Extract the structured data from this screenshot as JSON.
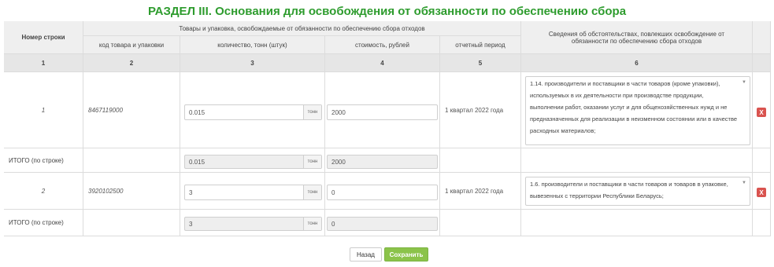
{
  "section_title": "РАЗДЕЛ III. Основания для освобождения от обязанности по обеспечению сбора",
  "headers": {
    "row_number": "Номер строки",
    "goods_group": "Товары и упаковка, освобождаемые от обязанности по обеспечению сбора отходов",
    "code": "код товара и упаковки",
    "quantity": "количество, тонн (штук)",
    "cost": "стоимость, рублей",
    "period": "отчетный период",
    "circumstances": "Сведения об обстоятельствах, повлекших освобождение от обязанности по обеспечению сбора отходов"
  },
  "column_numbers": [
    "1",
    "2",
    "3",
    "4",
    "5",
    "6"
  ],
  "rows": [
    {
      "number": "1",
      "code": "8467119000",
      "quantity": "0.015",
      "unit": "тонн",
      "cost": "2000",
      "period": "1 квартал 2022 года",
      "reason": "1.14. производители и поставщики в части товаров (кроме упаковки), используемых в их деятельности при производстве продукции, выполнении работ, оказании услуг и для общехозяйственных нужд и не предназначенных для реализации в неизменном состоянии или в качестве расходных материалов;",
      "total_label": "ИТОГО (по строке)",
      "total_quantity": "0.015",
      "total_cost": "2000"
    },
    {
      "number": "2",
      "code": "3920102500",
      "quantity": "3",
      "unit": "тонн",
      "cost": "0",
      "period": "1 квартал 2022 года",
      "reason": "1.6. производители и поставщики в части товаров и товаров в упаковке, вывезенных с территории Республики Беларусь;",
      "total_label": "ИТОГО (по строке)",
      "total_quantity": "3",
      "total_cost": "0"
    }
  ],
  "delete_label": "X",
  "buttons": {
    "back": "Назад",
    "save": "Сохранить"
  },
  "colors": {
    "title": "#2e9c2e",
    "save": "#8bc34a",
    "delete": "#d9534f"
  },
  "icons": {
    "dropdown": "caret-down-icon",
    "delete": "close-icon"
  }
}
